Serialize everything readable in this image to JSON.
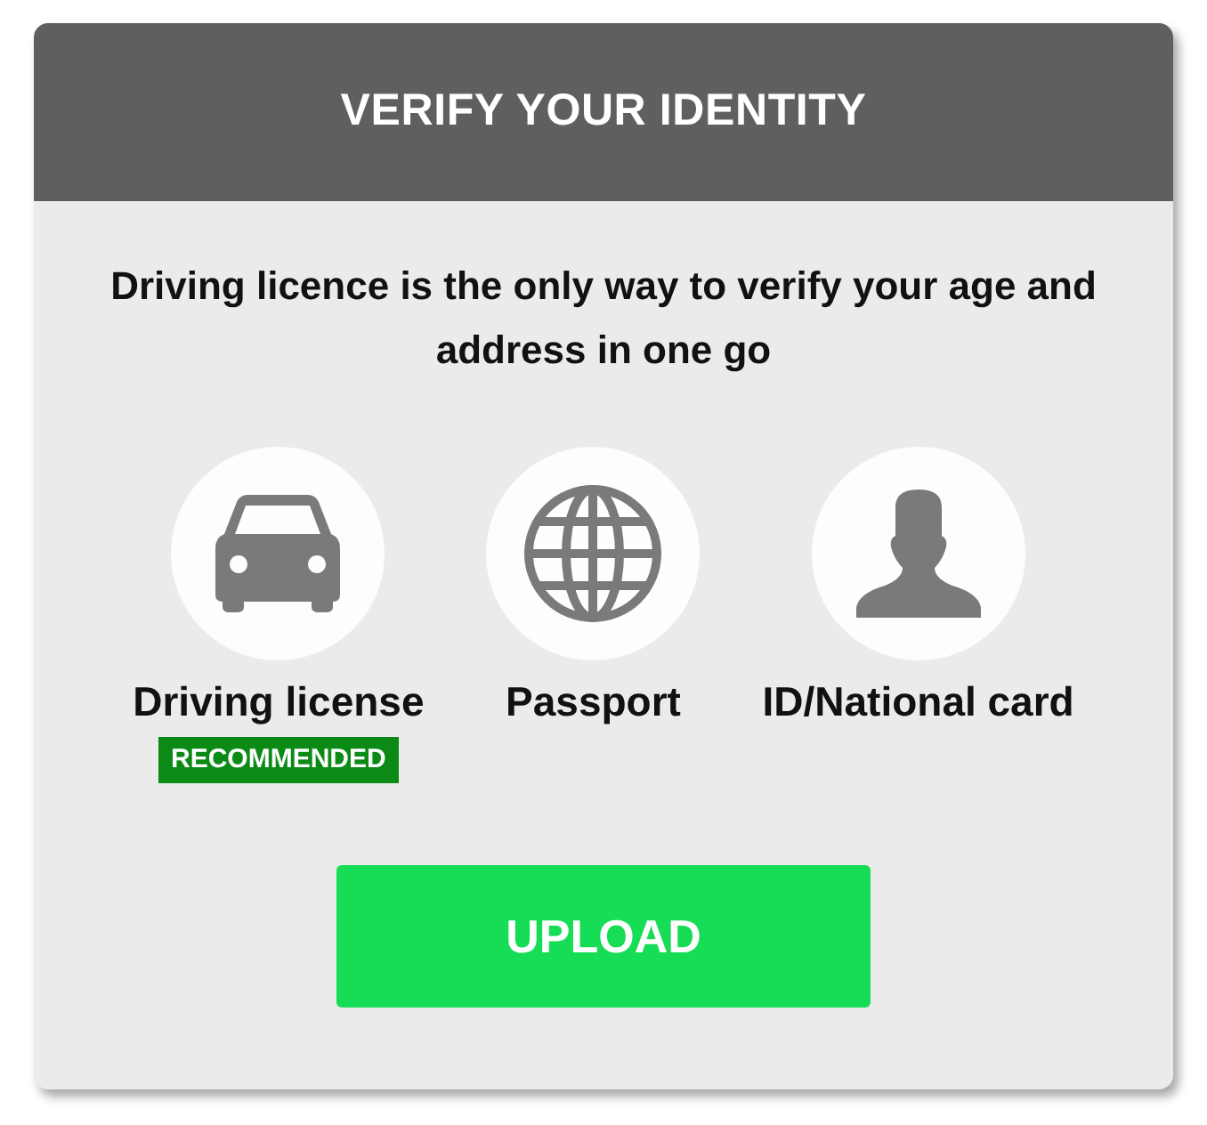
{
  "dialog": {
    "title": "VERIFY YOUR IDENTITY",
    "message": "Driving licence is the only way to verify your age and address in one go",
    "options": [
      {
        "kind": "car",
        "label": "Driving license",
        "badge": "RECOMMENDED"
      },
      {
        "kind": "globe",
        "label": "Passport"
      },
      {
        "kind": "person",
        "label": "ID/National card"
      }
    ],
    "button": "UPLOAD"
  }
}
